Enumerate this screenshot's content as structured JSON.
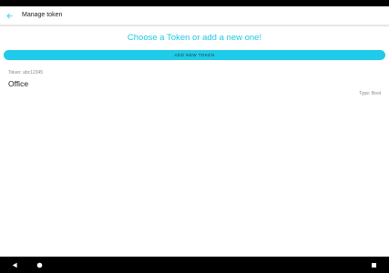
{
  "app_bar": {
    "title": "Manage token",
    "back_icon": "arrow-left-icon",
    "accent": "#1ec8e6"
  },
  "main": {
    "headline": "Choose a Token or add a new one!",
    "add_button_label": "ADD NEW TOKEN",
    "accent": "#1ecbe8"
  },
  "tokens": [
    {
      "meta": "Token: abc12345",
      "name": "Office",
      "type": "Type: Boot"
    }
  ],
  "nav_bar": {
    "back_icon": "triangle-back-icon",
    "home_icon": "circle-home-icon",
    "recents_icon": "square-recents-icon"
  }
}
